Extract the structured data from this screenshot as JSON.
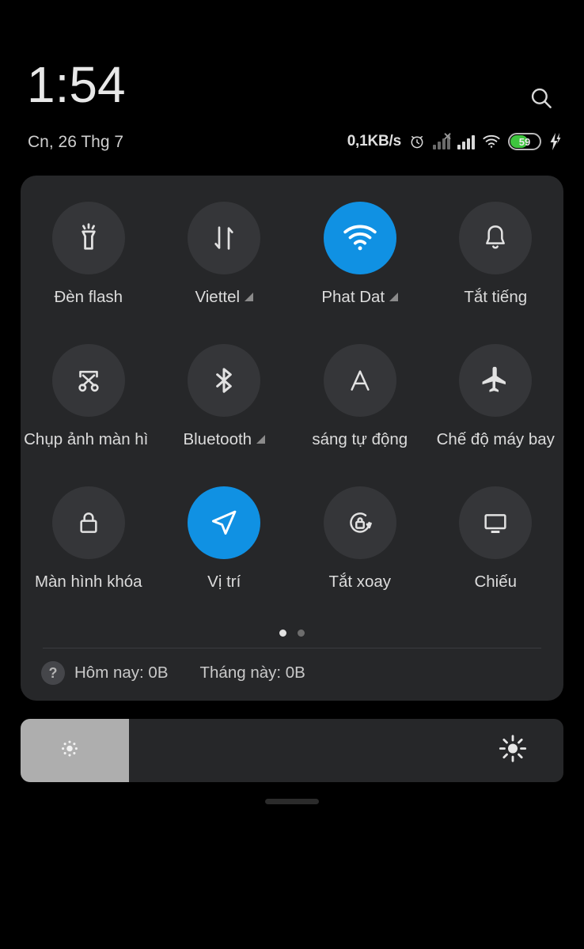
{
  "statusbar": {
    "clock": "1:54",
    "date": "Cn, 26 Thg 7",
    "net_speed": "0,1KB/s",
    "battery_percent": "59",
    "battery_color": "#3ec63e",
    "icons": [
      "alarm-clock-icon",
      "signal-no-service-icon",
      "signal-bars-icon",
      "wifi-icon",
      "battery-icon",
      "charging-bolt-icon"
    ],
    "search_icon": "search-icon"
  },
  "quick_settings": {
    "accent_color": "#1091e3",
    "tile_bg": "#353639",
    "panel_bg": "#262729",
    "rows": [
      [
        {
          "label": "Đèn flash",
          "icon": "flashlight-icon",
          "active": false,
          "expandable": false
        },
        {
          "label": "Viettel",
          "icon": "mobile-data-icon",
          "active": false,
          "expandable": true
        },
        {
          "label": "Phat Dat",
          "icon": "wifi-icon",
          "active": true,
          "expandable": true
        },
        {
          "label": "Tắt tiếng",
          "icon": "bell-icon",
          "active": false,
          "expandable": false
        }
      ],
      [
        {
          "label": "Chụp ảnh màn hì",
          "icon": "screenshot-icon",
          "active": false,
          "expandable": false
        },
        {
          "label": "Bluetooth",
          "icon": "bluetooth-icon",
          "active": false,
          "expandable": true
        },
        {
          "label": "sáng tự động",
          "icon": "auto-brightness-icon",
          "active": false,
          "expandable": false
        },
        {
          "label": "Chế độ máy bay",
          "icon": "airplane-icon",
          "active": false,
          "expandable": false
        }
      ],
      [
        {
          "label": "Màn hình khóa",
          "icon": "lock-icon",
          "active": false,
          "expandable": false
        },
        {
          "label": "Vị trí",
          "icon": "location-arrow-icon",
          "active": true,
          "expandable": false
        },
        {
          "label": "Tắt xoay",
          "icon": "rotation-lock-icon",
          "active": false,
          "expandable": false
        },
        {
          "label": "Chiếu",
          "icon": "cast-screen-icon",
          "active": false,
          "expandable": false
        }
      ]
    ],
    "pager": {
      "total": 2,
      "active_index": 0
    }
  },
  "data_usage": {
    "help_icon": "question-mark-icon",
    "today_label": "Hôm nay: 0B",
    "month_label": "Tháng này: 0B"
  },
  "brightness": {
    "level_percent": "20",
    "low_icon": "brightness-low-icon",
    "high_icon": "brightness-high-icon"
  },
  "navigation": {
    "home_indicator": "home-indicator"
  }
}
